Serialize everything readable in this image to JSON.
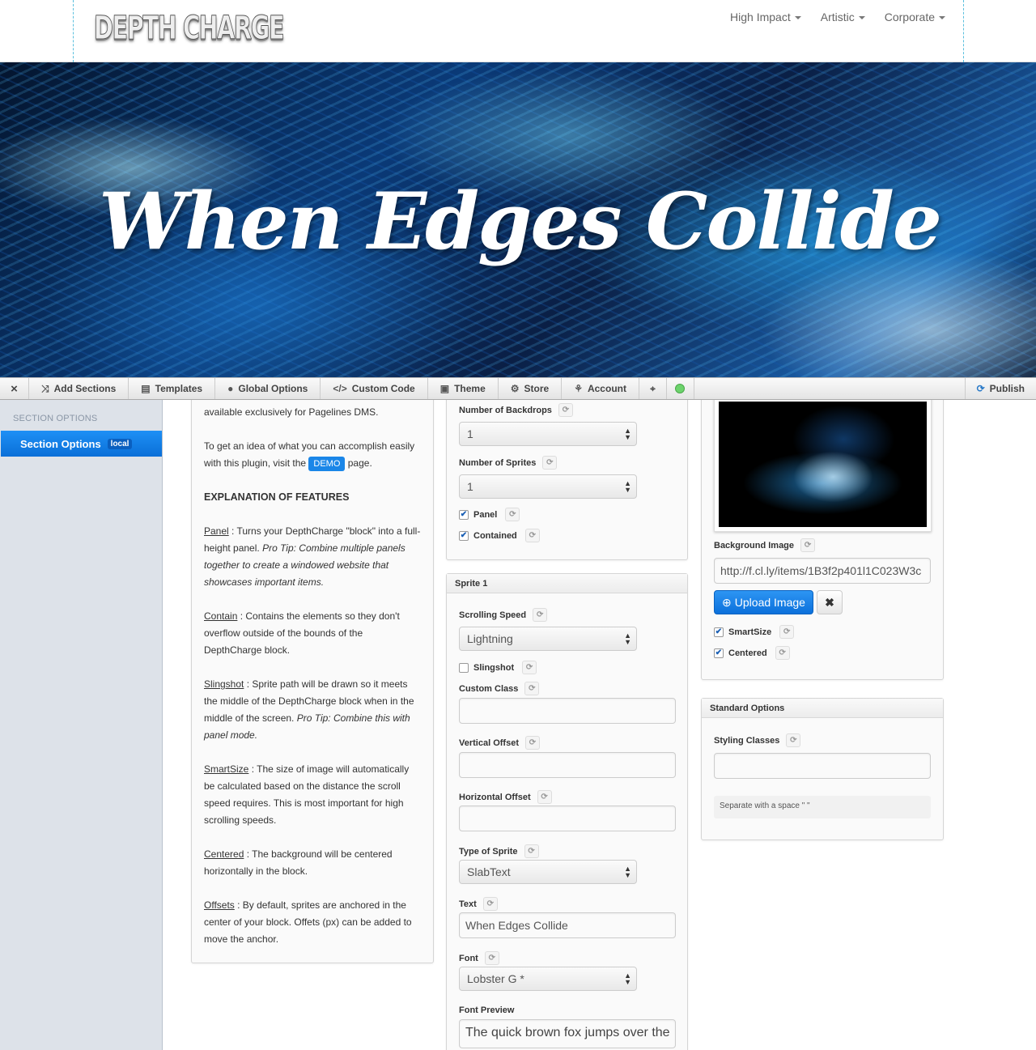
{
  "header": {
    "logo": "DEPTH CHARGE",
    "nav": [
      {
        "label": "High Impact"
      },
      {
        "label": "Artistic"
      },
      {
        "label": "Corporate"
      }
    ]
  },
  "hero": {
    "title": "When Edges Collide"
  },
  "toolbar": {
    "close_icon": "×",
    "add_sections": "Add Sections",
    "templates": "Templates",
    "global_options": "Global Options",
    "custom_code": "Custom Code",
    "theme": "Theme",
    "store": "Store",
    "account": "Account",
    "publish": "Publish",
    "status_color": "#6cd36c"
  },
  "sidebar": {
    "heading": "SECTION OPTIONS",
    "item_label": "Section Options",
    "item_badge": "local"
  },
  "description": {
    "intro_tail": "available exclusively for Pagelines DMS.",
    "demo_pre": "To get an idea of what you can accomplish easily with this plugin, visit the",
    "demo_button": "DEMO",
    "demo_post": "page.",
    "heading": "EXPLANATION OF FEATURES",
    "panel_term": "Panel",
    "panel_text": " : Turns your DepthCharge \"block\" into a full-height panel. ",
    "panel_tip": "Pro Tip: Combine multiple panels together to create a windowed website that showcases important items.",
    "contain_term": "Contain",
    "contain_text": " : Contains the elements so they don't overflow outside of the bounds of the DepthCharge block.",
    "slingshot_term": "Slingshot",
    "slingshot_text": " : Sprite path will be drawn so it meets the middle of the DepthCharge block when in the middle of the screen. ",
    "slingshot_tip": "Pro Tip: Combine this with panel mode.",
    "smartsize_term": "SmartSize",
    "smartsize_text": " : The size of image will automatically be calculated based on the distance the scroll speed requires. This is most important for high scrolling speeds.",
    "centered_term": "Centered",
    "centered_text": " : The background will be centered horizontally in the block.",
    "offsets_term": "Offsets",
    "offsets_text": " : By default, sprites are anchored in the center of your block. Offets (px) can be added to move the anchor."
  },
  "backdrops": {
    "num_backdrops_label": "Number of Backdrops",
    "num_backdrops_value": "1",
    "num_sprites_label": "Number of Sprites",
    "num_sprites_value": "1",
    "panel_label": "Panel",
    "panel_checked": true,
    "contained_label": "Contained",
    "contained_checked": true
  },
  "sprite": {
    "header": "Sprite 1",
    "speed_label": "Scrolling Speed",
    "speed_value": "Lightning",
    "slingshot_label": "Slingshot",
    "slingshot_checked": false,
    "custom_class_label": "Custom Class",
    "custom_class_value": "",
    "v_offset_label": "Vertical Offset",
    "v_offset_value": "",
    "h_offset_label": "Horizontal Offset",
    "h_offset_value": "",
    "type_label": "Type of Sprite",
    "type_value": "SlabText",
    "text_label": "Text",
    "text_value": "When Edges Collide",
    "font_label": "Font",
    "font_value": "Lobster G *",
    "preview_label": "Font Preview",
    "preview_text": "The quick brown fox jumps over the"
  },
  "background": {
    "bg_image_label": "Background Image",
    "bg_image_value": "http://f.cl.ly/items/1B3f2p401l1C023W3c",
    "upload_label": "Upload Image",
    "remove_icon": "✖",
    "smartsize_label": "SmartSize",
    "smartsize_checked": true,
    "centered_label": "Centered",
    "centered_checked": true
  },
  "standard": {
    "header": "Standard Options",
    "styling_label": "Styling Classes",
    "styling_value": "",
    "help": "Separate with a space \" \""
  }
}
